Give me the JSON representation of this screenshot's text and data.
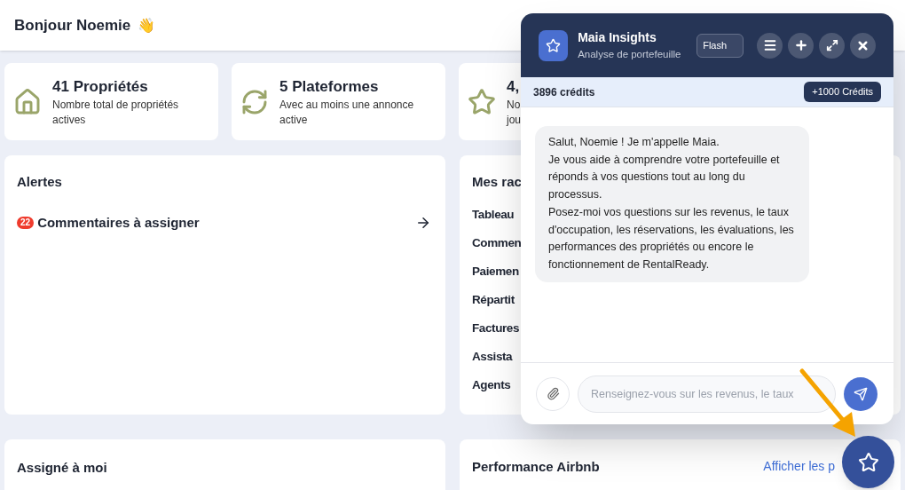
{
  "header": {
    "greeting": "Bonjour Noemie",
    "emoji": "👋"
  },
  "stats": [
    {
      "kind": "house",
      "value": "41 Propriétés",
      "description": "Nombre total de propriétés actives"
    },
    {
      "kind": "refresh",
      "value": "5 Plateformes",
      "description": "Avec au moins une annonce active"
    },
    {
      "kind": "star",
      "value": "4,",
      "description_lines": [
        "No",
        "jou"
      ]
    }
  ],
  "alerts": {
    "title": "Alertes",
    "items": [
      {
        "count": "22",
        "label": "Commentaires à assigner"
      }
    ]
  },
  "shortcuts": {
    "title": "Mes rac",
    "items": [
      "Tableau",
      "Commen",
      "Paiemen",
      "Répartit",
      "Factures",
      "Assista",
      "Agents"
    ]
  },
  "assigned": {
    "title": "Assigné à moi"
  },
  "airbnb": {
    "title": "Performance Airbnb",
    "link": "Afficher les p"
  },
  "chat": {
    "title": "Maia Insights",
    "subtitle": "Analyse de portefeuille",
    "model": "Flash",
    "credits": "3896 crédits",
    "buy_button": "+1000 Crédits",
    "messages": [
      {
        "paragraphs": [
          "Salut, Noemie ! Je m'appelle Maia.",
          "Je vous aide à comprendre votre portefeuille et réponds à vos questions tout au long du processus.",
          "Posez-moi vos questions sur les revenus, le taux d'occupation, les réservations, les évaluations, les performances des propriétés ou encore le fonctionnement de RentalReady."
        ]
      }
    ],
    "placeholder": "Renseignez-vous sur les revenus, le taux"
  }
}
